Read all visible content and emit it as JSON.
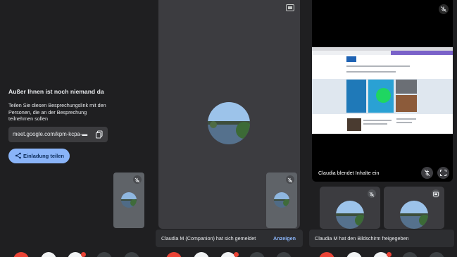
{
  "panel_left": {
    "heading": "Außer Ihnen ist noch niemand da",
    "description": "Teilen Sie diesen Besprechungslink mit den Personen, die an der Besprechung teilnehmen sollen",
    "meeting_link": "meet.google.com/kpm-kcpa-▬",
    "invite_button": "Einladung teilen",
    "icons": [
      "copy-icon",
      "share-icon",
      "mic-off-icon"
    ]
  },
  "panel_middle": {
    "notification": "Claudia M (Companion) hat sich gemeldet",
    "notification_action": "Anzeigen",
    "icons": [
      "pin-icon",
      "mic-off-icon"
    ]
  },
  "panel_right": {
    "presentation_label": "Claudia blendet Inhalte ein",
    "notification": "Claudia M hat den Bildschirm freigegeben",
    "icons": [
      "mic-off-icon",
      "unpin-icon",
      "fullscreen-icon",
      "present-icon"
    ]
  },
  "colors": {
    "background": "#1f1f21",
    "tile": "#3c3c40",
    "accent": "#8ab4f8",
    "end_call": "#ea4335"
  }
}
